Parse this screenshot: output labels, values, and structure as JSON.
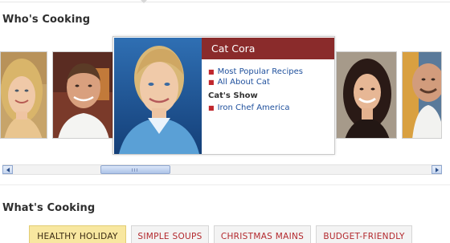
{
  "whos_cooking": {
    "title": "Who's Cooking",
    "chefs": [
      {
        "photo_icon": "chef-portrait-blonde-woman"
      },
      {
        "photo_icon": "chef-portrait-man-chef-coat"
      },
      {
        "photo_icon": "chef-portrait-dark-haired-woman"
      },
      {
        "photo_icon": "chef-portrait-bald-man"
      }
    ],
    "featured": {
      "name": "Cat Cora",
      "links": [
        "Most Popular Recipes",
        "All About Cat"
      ],
      "show_heading": "Cat's Show",
      "show_links": [
        "Iron Chef America"
      ],
      "header_color": "#8a2b2b",
      "link_color": "#1e4f9c"
    }
  },
  "scroll": {
    "position": 0.25,
    "left_icon": "scroll-left-arrow-icon",
    "right_icon": "scroll-right-arrow-icon"
  },
  "whats_cooking": {
    "title": "What's Cooking",
    "tabs": [
      {
        "label": "Healthy Holiday",
        "active": true
      },
      {
        "label": "Simple Soups",
        "active": false
      },
      {
        "label": "Christmas Mains",
        "active": false
      },
      {
        "label": "Budget-Friendly",
        "active": false
      }
    ],
    "active_tab_color": "#f8e7a0",
    "tab_text_color": "#b3282d"
  }
}
